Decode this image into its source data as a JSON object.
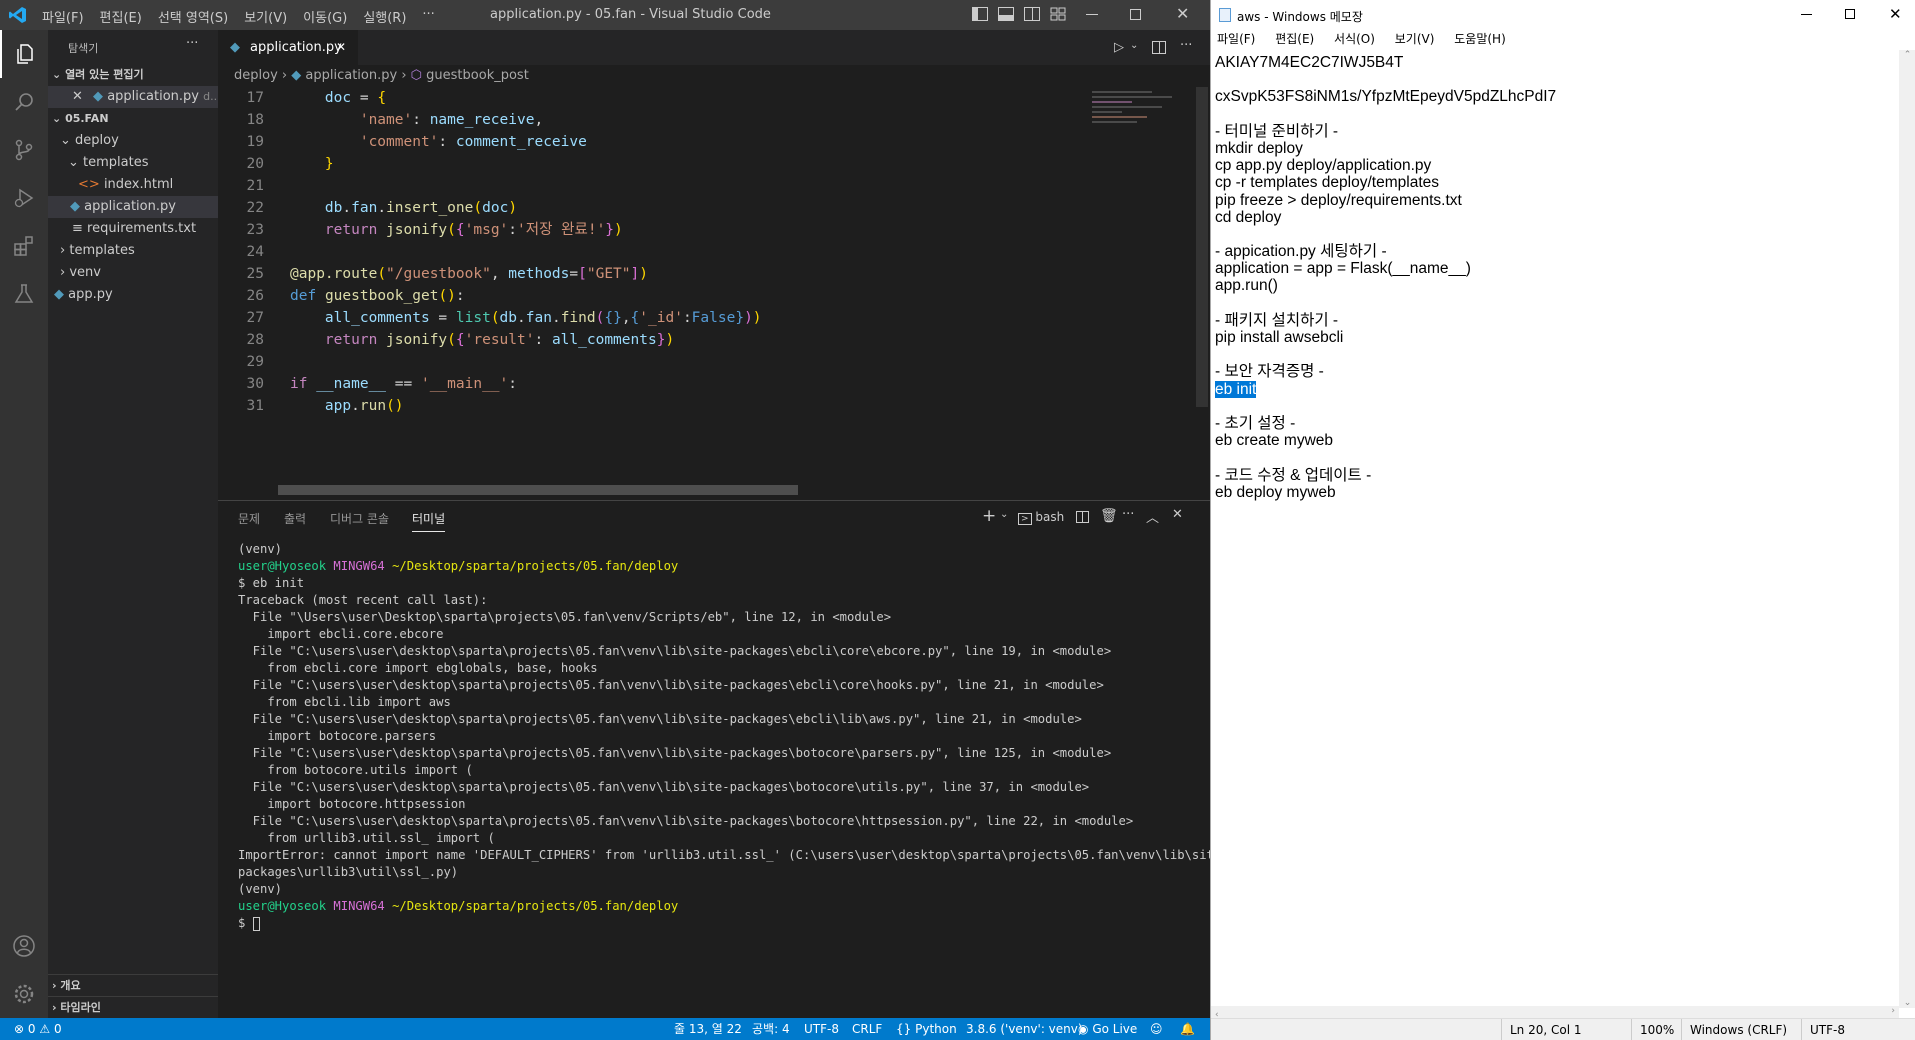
{
  "vscode": {
    "window_title": "application.py - 05.fan - Visual Studio Code",
    "menu": [
      "파일(F)",
      "편집(E)",
      "선택 영역(S)",
      "보기(V)",
      "이동(G)",
      "실행(R)",
      "···"
    ],
    "sidebar": {
      "header": "탐색기",
      "open_editors_label": "열려 있는 편집기",
      "open_editor_item": "application.py",
      "open_editor_suffix": "d...",
      "project_label": "05.FAN",
      "tree": [
        {
          "label": "deploy",
          "icon": "chevron-down"
        },
        {
          "label": "templates",
          "icon": "chevron-down"
        },
        {
          "label": "index.html",
          "icon": "html-file"
        },
        {
          "label": "application.py",
          "icon": "python-file",
          "selected": true
        },
        {
          "label": "requirements.txt",
          "icon": "text-file"
        },
        {
          "label": "templates",
          "icon": "chevron-right"
        },
        {
          "label": "venv",
          "icon": "chevron-right"
        },
        {
          "label": "app.py",
          "icon": "python-file"
        }
      ],
      "outline_label": "개요",
      "timeline_label": "타임라인"
    },
    "editor": {
      "tab_label": "application.py",
      "breadcrumbs": [
        "deploy",
        "application.py",
        "guestbook_post"
      ],
      "line_numbers": [
        "17",
        "18",
        "19",
        "20",
        "21",
        "22",
        "23",
        "24",
        "25",
        "26",
        "27",
        "28",
        "29",
        "30",
        "31"
      ]
    },
    "panel": {
      "tabs": [
        "문제",
        "출력",
        "디버그 콘솔",
        "터미널"
      ],
      "active_tab": "터미널",
      "shell_label": "bash",
      "terminal_lines": [
        "(venv)",
        "user@Hyoseok MINGW64 ~/Desktop/sparta/projects/05.fan/deploy",
        "$ eb init",
        "Traceback (most recent call last):",
        "  File \"\\Users\\user\\Desktop\\sparta\\projects\\05.fan\\venv/Scripts/eb\", line 12, in <module>",
        "    import ebcli.core.ebcore",
        "  File \"C:\\users\\user\\desktop\\sparta\\projects\\05.fan\\venv\\lib\\site-packages\\ebcli\\core\\ebcore.py\", line 19, in <module>",
        "    from ebcli.core import ebglobals, base, hooks",
        "  File \"C:\\users\\user\\desktop\\sparta\\projects\\05.fan\\venv\\lib\\site-packages\\ebcli\\core\\hooks.py\", line 21, in <module>",
        "    from ebcli.lib import aws",
        "  File \"C:\\users\\user\\desktop\\sparta\\projects\\05.fan\\venv\\lib\\site-packages\\ebcli\\lib\\aws.py\", line 21, in <module>",
        "    import botocore.parsers",
        "  File \"C:\\users\\user\\desktop\\sparta\\projects\\05.fan\\venv\\lib\\site-packages\\botocore\\parsers.py\", line 125, in <module>",
        "    from botocore.utils import (",
        "  File \"C:\\users\\user\\desktop\\sparta\\projects\\05.fan\\venv\\lib\\site-packages\\botocore\\utils.py\", line 37, in <module>",
        "    import botocore.httpsession",
        "  File \"C:\\users\\user\\desktop\\sparta\\projects\\05.fan\\venv\\lib\\site-packages\\botocore\\httpsession.py\", line 22, in <module>",
        "    from urllib3.util.ssl_ import (",
        "ImportError: cannot import name 'DEFAULT_CIPHERS' from 'urllib3.util.ssl_' (C:\\users\\user\\desktop\\sparta\\projects\\05.fan\\venv\\lib\\site-",
        "packages\\urllib3\\util\\ssl_.py)",
        "(venv)",
        "user@Hyoseok MINGW64 ~/Desktop/sparta/projects/05.fan/deploy",
        "$ "
      ]
    },
    "status": {
      "errors": "0",
      "warnings": "0",
      "position": "줄 13, 열 22",
      "spaces": "공백: 4",
      "encoding": "UTF-8",
      "eol": "CRLF",
      "language": "Python",
      "interpreter": "3.8.6 ('venv': venv)",
      "golive": "Go Live"
    }
  },
  "notepad": {
    "title": "aws - Windows 메모장",
    "menu": [
      "파일(F)",
      "편집(E)",
      "서식(O)",
      "보기(V)",
      "도움말(H)"
    ],
    "lines": [
      "AKIAY7M4EC2C7IWJ5B4T",
      "",
      "cxSvpK53FS8iNM1s/YfpzMtEpeydV5pdZLhcPdI7",
      "",
      "- 터미널 준비하기 -",
      "mkdir deploy",
      "cp app.py deploy/application.py",
      "cp -r templates deploy/templates",
      "pip freeze > deploy/requirements.txt",
      "cd deploy",
      "",
      "- appication.py 세팅하기 -",
      "application = app = Flask(__name__)",
      "app.run()",
      "",
      "- 패키지 설치하기 -",
      "pip install awsebcli",
      "",
      "- 보안 자격증명 -",
      "eb init",
      "",
      "- 초기 설정 -",
      "eb create myweb",
      "",
      "- 코드 수정 & 업데이트 -",
      "eb deploy myweb"
    ],
    "selected_line": "eb init",
    "status": {
      "position": "Ln 20, Col 1",
      "zoom": "100%",
      "eol": "Windows (CRLF)",
      "encoding": "UTF-8"
    }
  },
  "colors": {
    "accent": "#007acc",
    "selection": "#0078d7"
  }
}
